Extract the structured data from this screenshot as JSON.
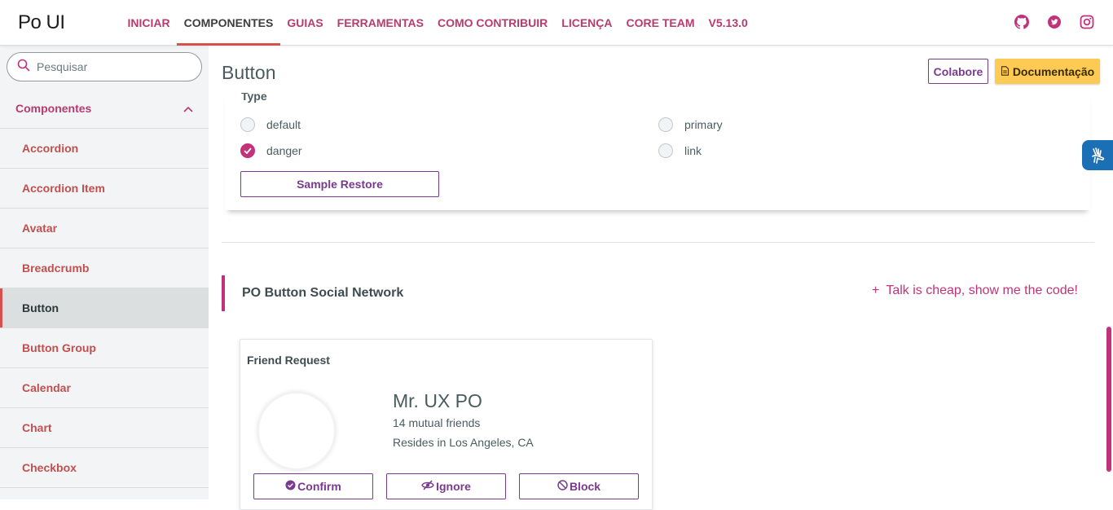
{
  "app": {
    "logo": "Po UI"
  },
  "nav": {
    "items": [
      {
        "label": "INICIAR"
      },
      {
        "label": "COMPONENTES",
        "active": true
      },
      {
        "label": "GUIAS"
      },
      {
        "label": "FERRAMENTAS"
      },
      {
        "label": "COMO CONTRIBUIR"
      },
      {
        "label": "LICENÇA"
      },
      {
        "label": "CORE TEAM"
      },
      {
        "label": "V5.13.0"
      }
    ],
    "social": [
      "github-icon",
      "twitter-icon",
      "instagram-icon"
    ]
  },
  "sidebar": {
    "search": {
      "placeholder": "Pesquisar",
      "value": ""
    },
    "group_label": "Componentes",
    "items": [
      {
        "label": "Accordion"
      },
      {
        "label": "Accordion Item"
      },
      {
        "label": "Avatar"
      },
      {
        "label": "Breadcrumb"
      },
      {
        "label": "Button",
        "active": true
      },
      {
        "label": "Button Group"
      },
      {
        "label": "Calendar"
      },
      {
        "label": "Chart"
      },
      {
        "label": "Checkbox"
      }
    ]
  },
  "main": {
    "title": "Button",
    "colabore_label": "Colabore",
    "doc_label": "Documentação",
    "sample": {
      "type_label": "Type",
      "options": [
        {
          "label": "default",
          "checked": false
        },
        {
          "label": "primary",
          "checked": false
        },
        {
          "label": "danger",
          "checked": true
        },
        {
          "label": "link",
          "checked": false
        }
      ],
      "restore_label": "Sample Restore"
    },
    "section": {
      "title": "PO Button Social Network",
      "code_link": "Talk is cheap, show me the code!",
      "code_icon": "+"
    },
    "friend_card": {
      "title": "Friend Request",
      "name": "Mr. UX PO",
      "mutual": "14 mutual friends",
      "resides": "Resides in Los Angeles, CA",
      "confirm_label": "Confirm",
      "ignore_label": "Ignore",
      "block_label": "Block"
    }
  },
  "colors": {
    "brand": "#c2327a",
    "nav_text": "#b83b6f",
    "active_underline": "#d75050",
    "button_outline": "#7a3a8f",
    "doc_button": "#fdcb54",
    "accessibility": "#1a6fb5"
  }
}
